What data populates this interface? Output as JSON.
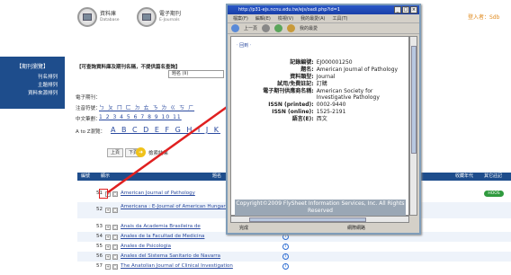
{
  "header": {
    "tools": [
      {
        "zh": "資料庫",
        "en": "Database"
      },
      {
        "zh": "電子期刊",
        "en": "E-Journals"
      }
    ],
    "login": "登入者：Sdb"
  },
  "sidebar": {
    "title": "【期刊瀏覽】",
    "items": [
      "刊名排列",
      "主題排列",
      "資料來源排列"
    ]
  },
  "query": {
    "title": "【可查詢資料庫及期刊名稱，不提供篇名查詢】",
    "name_label": "題名 (Ii)",
    "rows": [
      {
        "label": "電子期刊：",
        "value": ""
      },
      {
        "label": "注音符號：",
        "value": "ㄅ ㄆ ㄇ ㄈ ㄉ ㄊ ㄋ ㄌ ㄍ ㄎ ㄏ"
      },
      {
        "label": "中文筆劃：",
        "value": "1 2 3 4 5 6 7 8 9 10 11"
      }
    ],
    "az_label": "A to Z瀏覽：",
    "az_letters": "A B C D E F G H I J K"
  },
  "pager": {
    "prev": "上頁",
    "next": "下頁",
    "save_label": "檢索結果"
  },
  "table": {
    "headers": {
      "select": "編號",
      "display": "顯示",
      "title": "題名",
      "years": "收藏年代",
      "notes": "其它註記"
    },
    "rows": [
      {
        "num": "51",
        "title": "American Journal of Pathology",
        "tag": "HOOS"
      },
      {
        "num": "52",
        "title": "Americana : E-Journal of American Hungary",
        "tag": ""
      },
      {
        "num": "53",
        "title": "Anais da Academia Brasileira de",
        "tag": ""
      },
      {
        "num": "54",
        "title": "Anales de la Facultad de Medicina",
        "tag": ""
      },
      {
        "num": "55",
        "title": "Anales de Psicologia",
        "tag": ""
      },
      {
        "num": "56",
        "title": "Anales del Sistema Sanitario de Navarra",
        "tag": ""
      },
      {
        "num": "57",
        "title": "The Anatolian Journal of Clinical Investigation",
        "tag": ""
      }
    ]
  },
  "popup": {
    "title": "http://p31-ejs.ncnu.edu.tw/ejs/oadi.php?id=1",
    "menu": [
      "檔案(F)",
      "編輯(E)",
      "檢視(V)",
      "我的最愛(A)",
      "工具(T)"
    ],
    "nav": [
      "上一頁",
      "我的最愛"
    ],
    "return": "‧ 回到 ‧",
    "record": [
      {
        "label": "記錄編號:",
        "value": "EJ000001250"
      },
      {
        "label": "題名:",
        "value": "American Journal of Pathology"
      },
      {
        "label": "資料類型:",
        "value": "Journal"
      },
      {
        "label": "試用/免費註記:",
        "value": "訂購"
      },
      {
        "label": "電子期刊供應商名稱:",
        "value": "American Society for Investigative Pathology"
      },
      {
        "label": "ISSN (printed):",
        "value": "0002-9440"
      },
      {
        "label": "ISSN (online):",
        "value": "1525-2191"
      },
      {
        "label": "語言(E):",
        "value": "西文"
      }
    ],
    "footer": "Copyright©2009 FlySheet Information Services, Inc. All Rights Reserved",
    "status_left": "完成",
    "status_right": "網際網路"
  },
  "colors": {
    "nav_blue": "#1e4d8c",
    "link": "#2a4a9f",
    "arrow": "#e02020",
    "tag_green": "#2f9a3e"
  }
}
